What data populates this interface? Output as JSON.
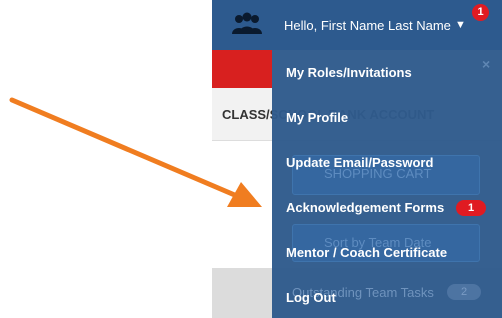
{
  "header": {
    "greeting": "Hello, First Name Last Name",
    "caret": "▼",
    "notification_count": "1",
    "users_icon": "users-icon"
  },
  "background": {
    "account_label": "CLASS/SCHOOL BANK ACCOUNT",
    "shopping_cart_label": "SHOPPING CART",
    "sort_label": "Sort by Team Date",
    "outstanding_label": "Outstanding Team Tasks",
    "outstanding_count": "2"
  },
  "menu": {
    "close_icon": "×",
    "items": [
      {
        "label": "My Roles/Invitations"
      },
      {
        "label": "My Profile"
      },
      {
        "label": "Update Email/Password"
      },
      {
        "label": "Acknowledgement Forms",
        "badge": "1"
      },
      {
        "label": "Mentor / Coach Certificate"
      },
      {
        "label": "Log Out"
      }
    ]
  },
  "colors": {
    "header_bg": "#2d5a8e",
    "menu_bg": "#2f5b8c",
    "badge_red": "#e01b22",
    "arrow": "#f07d20"
  }
}
